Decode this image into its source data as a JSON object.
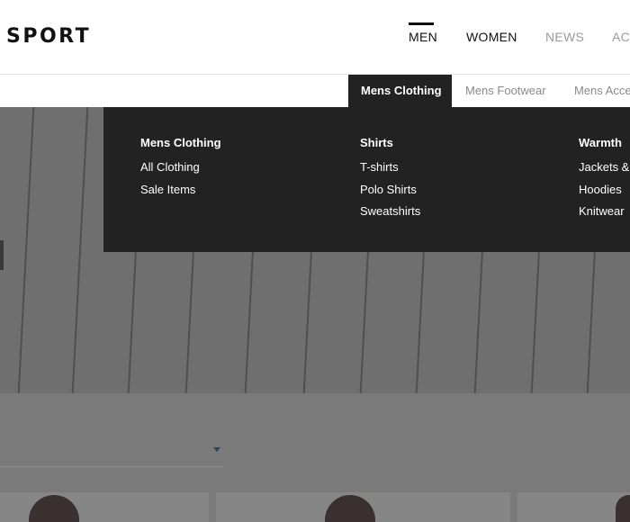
{
  "header": {
    "logo": "SPORT",
    "nav": [
      {
        "label": "MEN",
        "active": true
      },
      {
        "label": "WOMEN",
        "active": false
      },
      {
        "label": "NEWS",
        "active": false
      },
      {
        "label": "AC",
        "active": false
      }
    ]
  },
  "subnav": {
    "items": [
      {
        "label": "Mens Clothing",
        "active": true
      },
      {
        "label": "Mens Footwear",
        "active": false
      },
      {
        "label": "Mens Acce",
        "active": false
      }
    ]
  },
  "mega_menu": {
    "columns": [
      {
        "heading": "Mens Clothing",
        "links": [
          "All Clothing",
          "Sale Items"
        ]
      },
      {
        "heading": "Shirts",
        "links": [
          "T-shirts",
          "Polo Shirts",
          "Sweatshirts"
        ]
      },
      {
        "heading": "Warmth",
        "links": [
          "Jackets &",
          "Hoodies",
          "Knitwear"
        ]
      }
    ]
  },
  "colors": {
    "menu_bg": "#222222",
    "inactive_nav": "#9b9b9b",
    "accent_caret": "#26456b"
  },
  "icons": {
    "filter_caret": "caret-down-icon"
  }
}
